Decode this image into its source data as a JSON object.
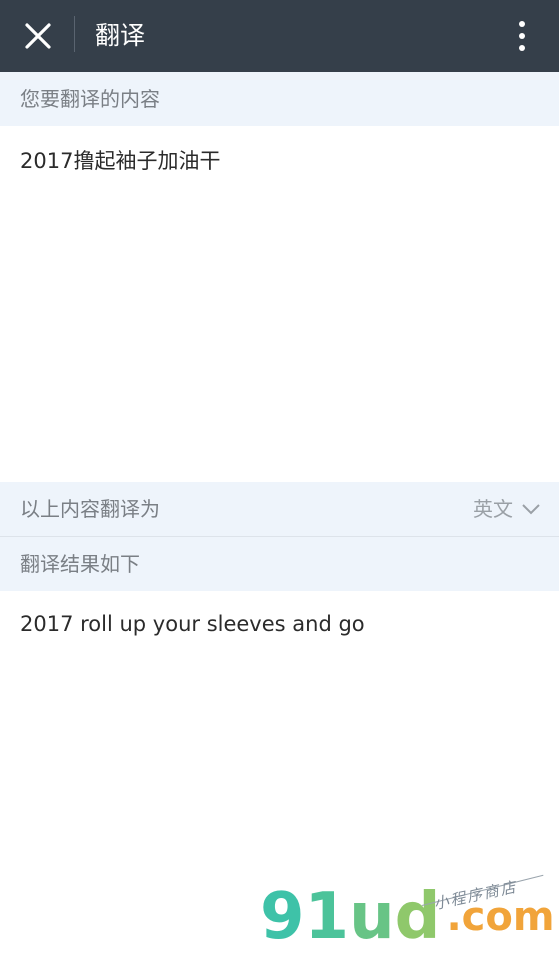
{
  "header": {
    "title": "翻译"
  },
  "input_section": {
    "label": "您要翻译的内容",
    "value": "2017撸起袖子加油干"
  },
  "target_section": {
    "label": "以上内容翻译为",
    "language": "英文"
  },
  "result_section": {
    "label": "翻译结果如下",
    "value": "2017 roll up your sleeves and go"
  },
  "watermark": {
    "brand_9": "9",
    "brand_1": "1",
    "brand_u": "u",
    "brand_d": "d",
    "dot": ".",
    "com": "com",
    "tagline": "小程序商店"
  },
  "colors": {
    "topbar": "#353f4a",
    "section_bg": "#eef4fb",
    "accent_orange": "#f1a43a",
    "accent_teal": "#3ec2a8"
  },
  "icons": {
    "close": "close-icon",
    "more": "more-vertical-icon",
    "dropdown": "chevron-down-icon"
  }
}
